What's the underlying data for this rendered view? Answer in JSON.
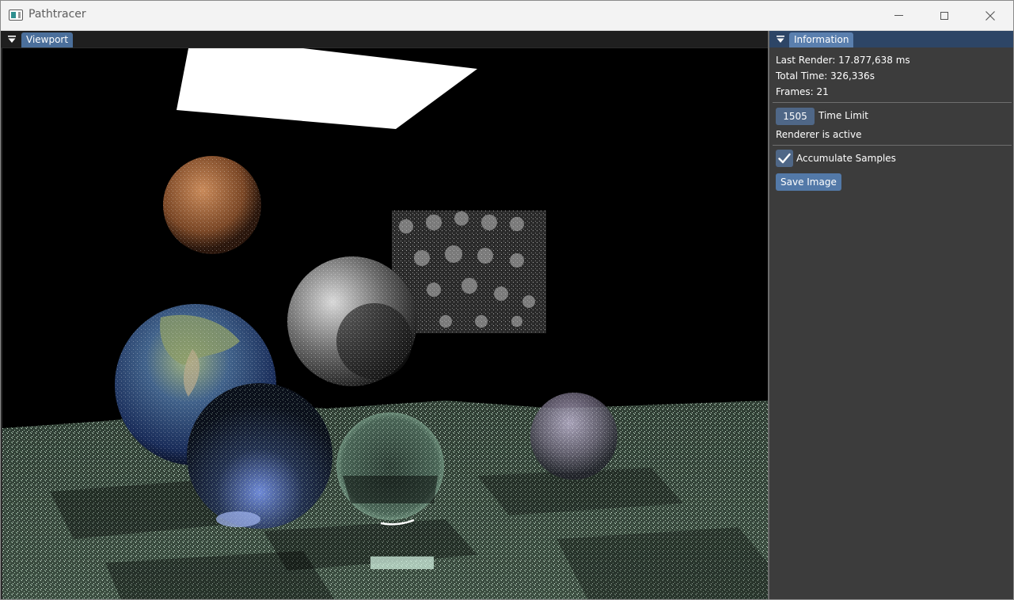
{
  "window": {
    "title": "Pathtracer",
    "app_icon": "app-icon",
    "controls": [
      "minimize-icon",
      "maximize-icon",
      "close-icon"
    ]
  },
  "viewport": {
    "tab_label": "Viewport",
    "menu_icon": "dropdown-triangle-icon"
  },
  "info": {
    "tab_label": "Information",
    "menu_icon": "dropdown-triangle-icon",
    "last_render": "Last Render: 17.877,638 ms",
    "total_time": "Total Time: 326,336s",
    "frames": "Frames: 21",
    "time_limit_value": "1505",
    "time_limit_label": "Time Limit",
    "status": "Renderer is active",
    "accumulate_label": "Accumulate Samples",
    "accumulate_checked": true,
    "save_label": "Save Image"
  },
  "colors": {
    "tab_active": "#4b6f9b",
    "panel_bg": "#3c3c3c",
    "button": "#5379a8",
    "field": "#4f6787"
  }
}
